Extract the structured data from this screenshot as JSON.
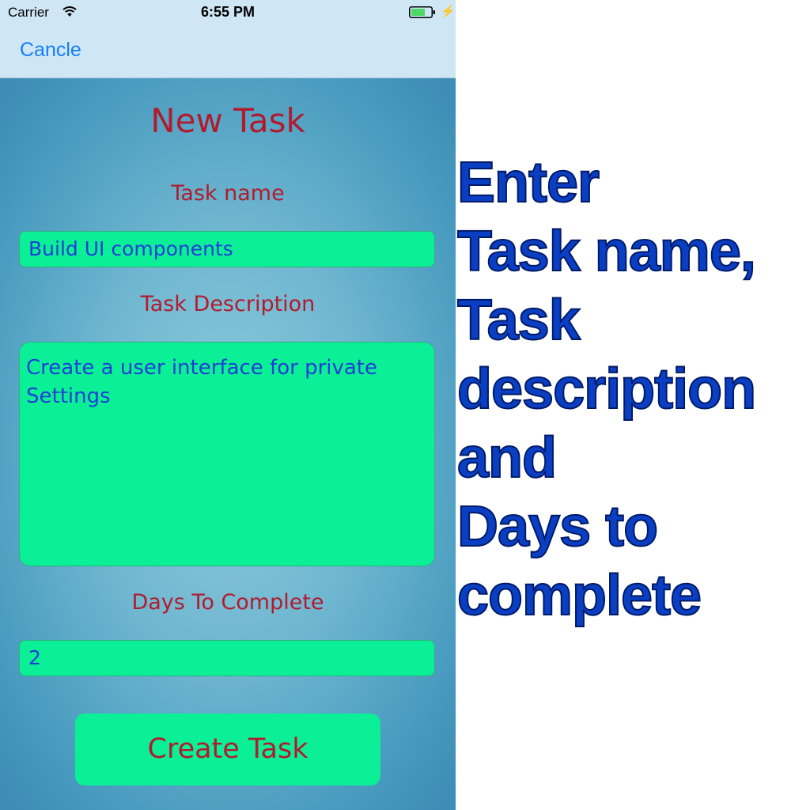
{
  "status_bar": {
    "carrier": "Carrier",
    "time": "6:55 PM",
    "wifi_icon": "wifi-icon",
    "battery_icon": "battery-charging-icon"
  },
  "nav": {
    "cancel_label": "Cancle"
  },
  "form": {
    "title": "New Task",
    "task_name_label": "Task name",
    "task_name_value": "Build UI components",
    "task_description_label": "Task Description",
    "task_description_value": "Create a user interface for private Settings",
    "days_label": "Days To Complete",
    "days_value": "2",
    "create_button_label": "Create Task"
  },
  "caption": {
    "lines": [
      "Enter",
      "Task name,",
      "Task",
      "description",
      "and",
      "Days to",
      "complete"
    ]
  },
  "colors": {
    "field_bg": "#0bef96",
    "label_red": "#b01c2e",
    "input_text_blue": "#1d3fd8",
    "link_blue": "#147efb",
    "caption_blue": "#0a3fc4"
  }
}
